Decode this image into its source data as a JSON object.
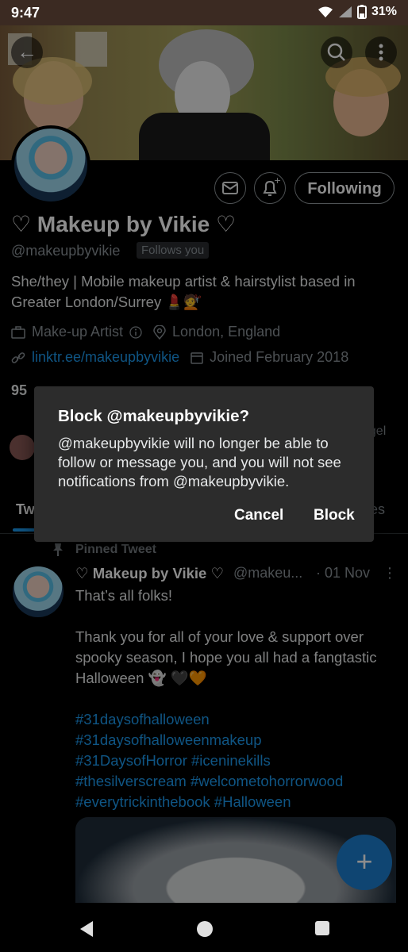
{
  "status_bar": {
    "time": "9:47",
    "battery": "31%"
  },
  "profile": {
    "display_name": "♡ Makeup by Vikie ♡",
    "handle": "@makeupbyvikie",
    "follows_you": "Follows you",
    "following_label": "Following",
    "bio": "She/they | Mobile makeup artist & hairstylist based in Greater London/Surrey 💄💇",
    "category": "Make-up Artist",
    "location": "London, England",
    "link": "linktr.ee/makeupbyvikie",
    "joined": "Joined February 2018",
    "follow_counts_visible": "95",
    "followed_by_partial_1": "ngel",
    "followed_by_partial_2": "el"
  },
  "tabs": {
    "tweets_partial": "Tw",
    "other_partial": "es"
  },
  "tweet": {
    "pinned_label": "Pinned Tweet",
    "name": "♡ Makeup by Vikie ♡",
    "handle": "@makeu...",
    "date": "· 01 Nov",
    "line1": "That’s all folks!",
    "line2": "Thank you for all of your love & support over spooky season, I hope you all had a fangtastic Halloween 👻 🖤🧡",
    "hashtags": [
      "#31daysofhalloween",
      "#31daysofhalloweenmakeup",
      "#31DaysofHorror #iceninekills",
      "#thesilverscream #welcometohorrorwood",
      "#everytrickinthebook #Halloween"
    ]
  },
  "dialog": {
    "title": "Block @makeupbyvikie?",
    "message": "@makeupbyvikie will no longer be able to follow or message you, and you will not see notifications from @makeupbyvikie.",
    "cancel_label": "Cancel",
    "block_label": "Block"
  },
  "fab": {
    "icon": "plus-icon"
  },
  "colors": {
    "accent": "#1d9bf0",
    "background": "#000000",
    "dialog": "#2c2c2c"
  }
}
